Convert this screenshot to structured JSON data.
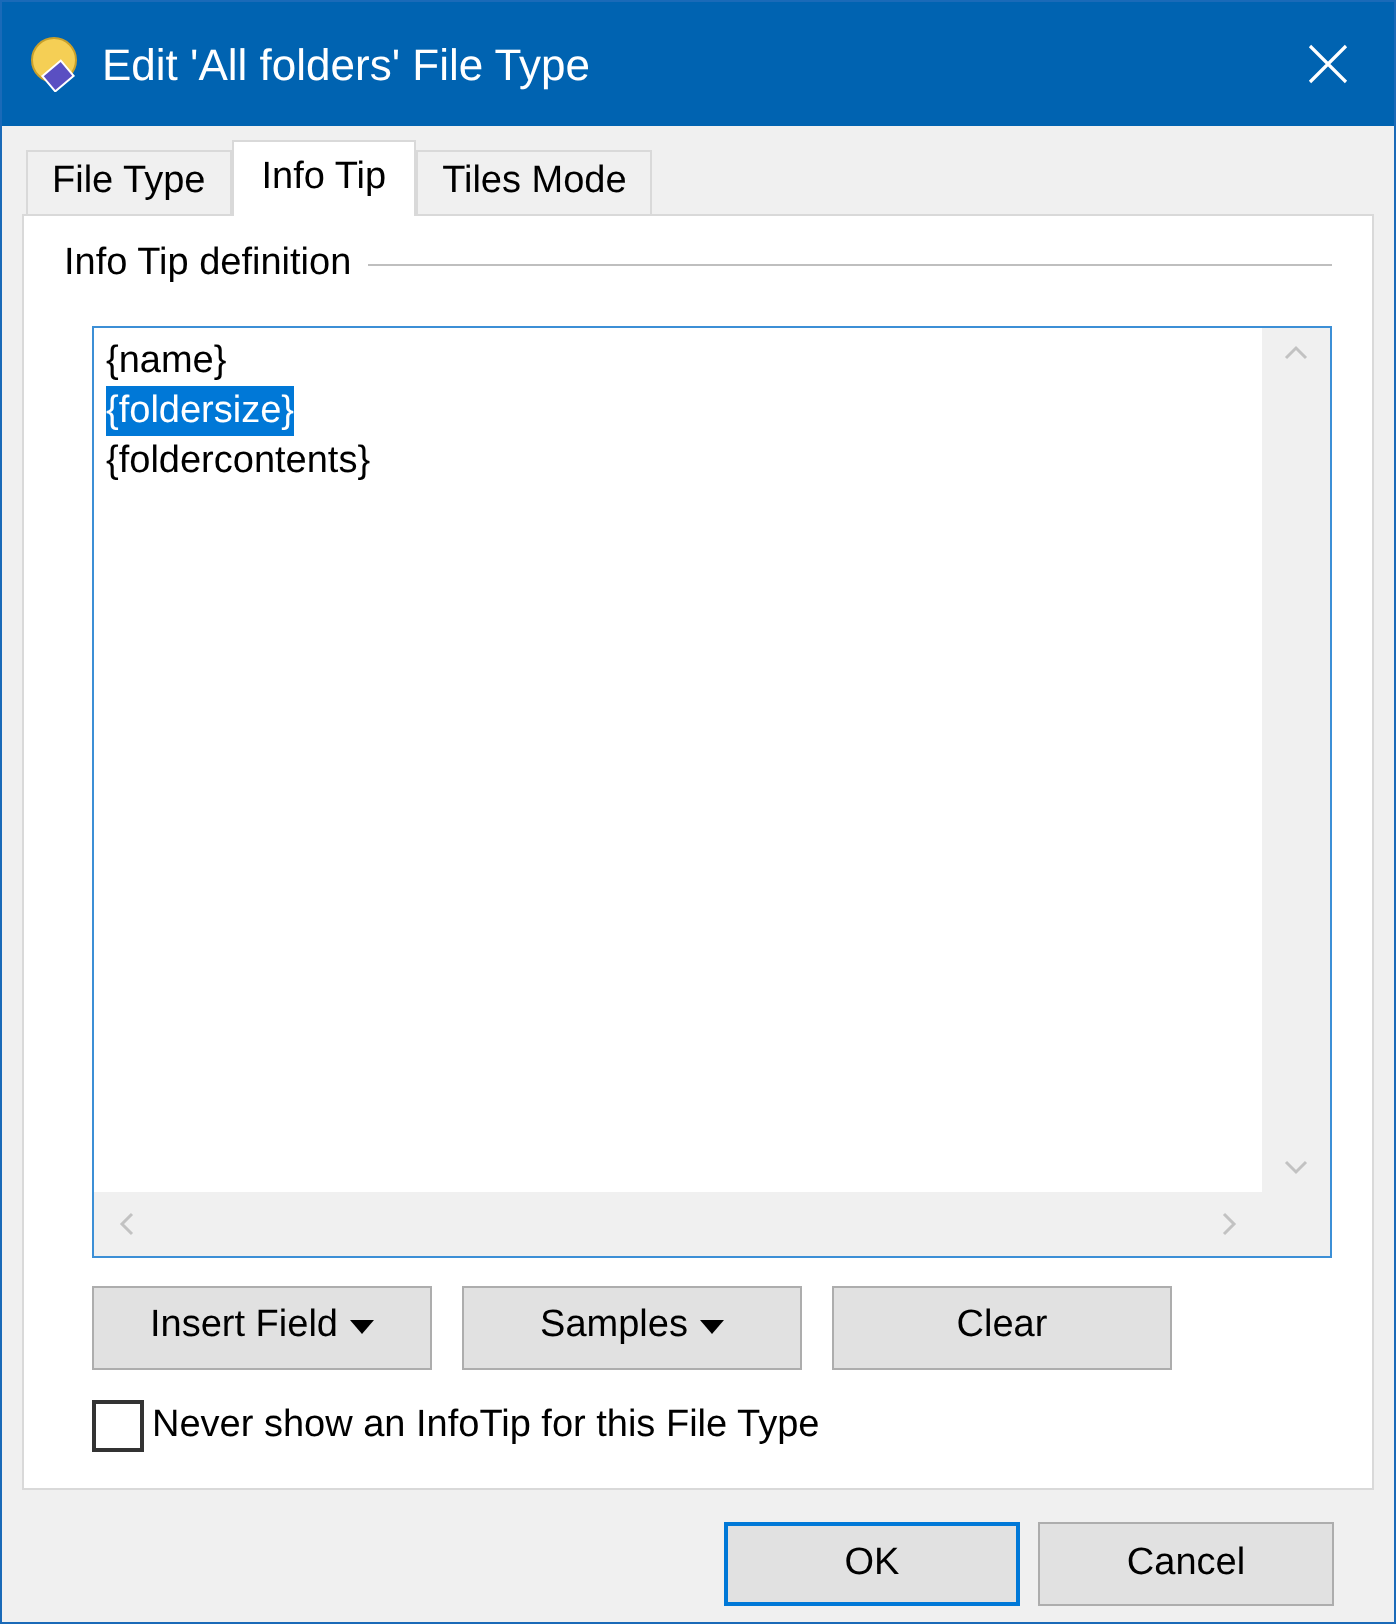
{
  "window": {
    "title": "Edit 'All folders' File Type"
  },
  "tabs": [
    {
      "label": "File Type",
      "selected": false
    },
    {
      "label": "Info Tip",
      "selected": true
    },
    {
      "label": "Tiles Mode",
      "selected": false
    }
  ],
  "group": {
    "title": "Info Tip definition"
  },
  "editor": {
    "lines": [
      {
        "text": "{name}",
        "selected": false
      },
      {
        "text": "{foldersize}",
        "selected": true
      },
      {
        "text": "{foldercontents}",
        "selected": false
      }
    ]
  },
  "buttons": [
    {
      "label": "Insert Field",
      "dropdown": true
    },
    {
      "label": "Samples",
      "dropdown": true
    },
    {
      "label": "Clear",
      "dropdown": false
    }
  ],
  "checkbox": {
    "label": "Never show an InfoTip for this File Type",
    "checked": false
  },
  "dialog_buttons": [
    {
      "label": "OK",
      "default": true
    },
    {
      "label": "Cancel",
      "default": false
    }
  ]
}
